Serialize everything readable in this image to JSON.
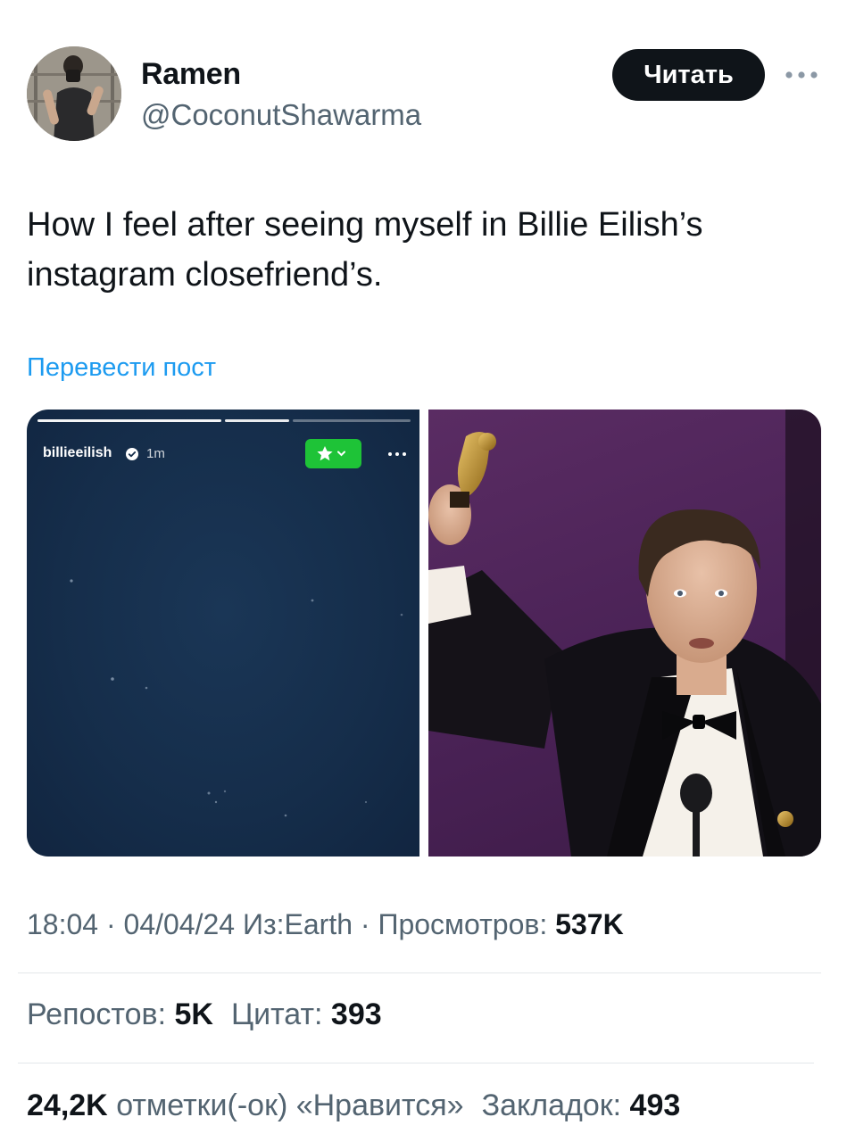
{
  "author": {
    "display_name": "Ramen",
    "handle": "@CoconutShawarma",
    "follow_label": "Читать"
  },
  "post": {
    "text": "How I feel after seeing myself in Billie Eilish’s instagram closefriend’s.",
    "translate_label": "Перевести пост"
  },
  "media": {
    "story": {
      "username": "billieeilish",
      "time": "1m"
    }
  },
  "meta": {
    "time": "18:04",
    "date": "04/04/24",
    "source": "Из:Earth",
    "views_label": "Просмотров:",
    "views_value": "537K"
  },
  "stats": {
    "reposts_label": "Репостов:",
    "reposts_value": "5K",
    "quotes_label": "Цитат:",
    "quotes_value": "393",
    "likes_value": "24,2K",
    "likes_label": "отметки(-ок) «Нравится»",
    "bookmarks_label": "Закладок:",
    "bookmarks_value": "493"
  },
  "colors": {
    "link": "#1d9bf0",
    "secondary_text": "#536471",
    "primary_text": "#0f1419",
    "close_friends": "#1ec337"
  }
}
